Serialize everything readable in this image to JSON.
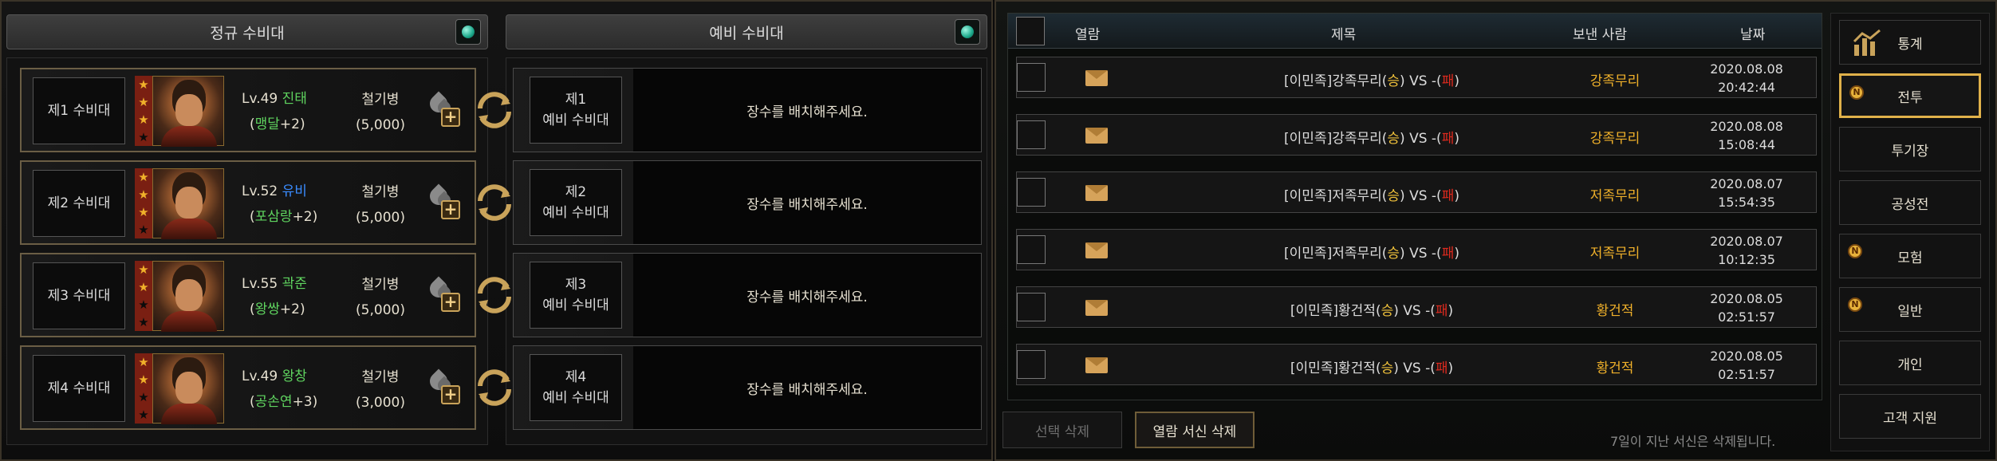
{
  "left": {
    "regular_header": "정규 수비대",
    "reserve_header": "예비 수비대",
    "rows": [
      {
        "slot": "제1 수비대",
        "level": "Lv.49",
        "hero": "진태",
        "hero_color": "#5fd45f",
        "sub_name": "맹달",
        "sub_bonus": "+2",
        "troop_type": "철기병",
        "troop_count": "(5,000)",
        "stars": 3,
        "reserve_slot_line1": "제1",
        "reserve_slot_line2": "예비 수비대",
        "reserve_msg": "장수를 배치해주세요."
      },
      {
        "slot": "제2 수비대",
        "level": "Lv.52",
        "hero": "유비",
        "hero_color": "#3a8cff",
        "sub_name": "포삼랑",
        "sub_bonus": "+2",
        "troop_type": "철기병",
        "troop_count": "(5,000)",
        "stars": 3,
        "reserve_slot_line1": "제2",
        "reserve_slot_line2": "예비 수비대",
        "reserve_msg": "장수를 배치해주세요."
      },
      {
        "slot": "제3 수비대",
        "level": "Lv.55",
        "hero": "곽준",
        "hero_color": "#5fd45f",
        "sub_name": "왕쌍",
        "sub_bonus": "+2",
        "troop_type": "철기병",
        "troop_count": "(5,000)",
        "stars": 2,
        "reserve_slot_line1": "제3",
        "reserve_slot_line2": "예비 수비대",
        "reserve_msg": "장수를 배치해주세요."
      },
      {
        "slot": "제4 수비대",
        "level": "Lv.49",
        "hero": "왕창",
        "hero_color": "#5fd45f",
        "sub_name": "공손연",
        "sub_bonus": "+3",
        "troop_type": "철기병",
        "troop_count": "(3,000)",
        "stars": 2,
        "reserve_slot_line1": "제4",
        "reserve_slot_line2": "예비 수비대",
        "reserve_msg": "장수를 배치해주세요."
      }
    ]
  },
  "mail": {
    "headers": {
      "read": "열람",
      "subject": "제목",
      "sender": "보낸 사람",
      "date": "날짜"
    },
    "rows": [
      {
        "subject_prefix": "[이민족]강족무리(",
        "win": "승",
        "mid": ") VS -(",
        "lose": "패",
        "suffix": ")",
        "sender": "강족무리",
        "date": "2020.08.08",
        "time": "20:42:44"
      },
      {
        "subject_prefix": "[이민족]강족무리(",
        "win": "승",
        "mid": ") VS -(",
        "lose": "패",
        "suffix": ")",
        "sender": "강족무리",
        "date": "2020.08.08",
        "time": "15:08:44"
      },
      {
        "subject_prefix": "[이민족]저족무리(",
        "win": "승",
        "mid": ") VS -(",
        "lose": "패",
        "suffix": ")",
        "sender": "저족무리",
        "date": "2020.08.07",
        "time": "15:54:35"
      },
      {
        "subject_prefix": "[이민족]저족무리(",
        "win": "승",
        "mid": ") VS -(",
        "lose": "패",
        "suffix": ")",
        "sender": "저족무리",
        "date": "2020.08.07",
        "time": "10:12:35"
      },
      {
        "subject_prefix": "[이민족]황건적(",
        "win": "승",
        "mid": ") VS -(",
        "lose": "패",
        "suffix": ")",
        "sender": "황건적",
        "date": "2020.08.05",
        "time": "02:51:57"
      },
      {
        "subject_prefix": "[이민족]황건적(",
        "win": "승",
        "mid": ") VS -(",
        "lose": "패",
        "suffix": ")",
        "sender": "황건적",
        "date": "2020.08.05",
        "time": "02:51:57"
      }
    ],
    "delete_selected": "선택 삭제",
    "delete_read": "열람 서신 삭제",
    "notice": "7일이 지난 서신은 삭제됩니다."
  },
  "side_menu": {
    "items": [
      {
        "label": "통계",
        "badge": "",
        "active": false
      },
      {
        "label": "전투",
        "badge": "N",
        "active": true
      },
      {
        "label": "투기장",
        "badge": "",
        "active": false
      },
      {
        "label": "공성전",
        "badge": "",
        "active": false
      },
      {
        "label": "모험",
        "badge": "N",
        "active": false
      },
      {
        "label": "일반",
        "badge": "N",
        "active": false
      },
      {
        "label": "개인",
        "badge": "",
        "active": false
      },
      {
        "label": "고객 지원",
        "badge": "",
        "active": false
      }
    ]
  },
  "colors": {
    "accent_gold": "#e0b14a",
    "win": "#f1c23b",
    "lose": "#e02a1e",
    "sender": "#f0b12a"
  }
}
